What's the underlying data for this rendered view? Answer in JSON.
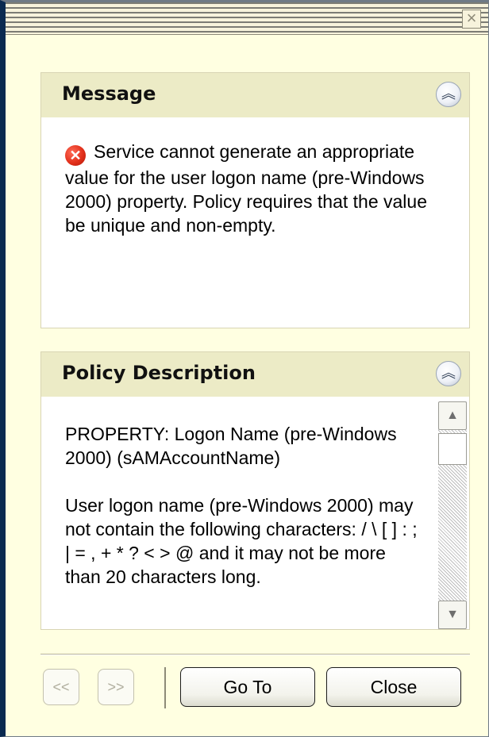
{
  "window": {
    "close_glyph": "×"
  },
  "message": {
    "title": "Message",
    "collapse_glyph": "︽",
    "error_glyph": "✕",
    "text": "Service cannot generate an appropriate value for the user logon name (pre-Windows 2000) property. Policy requires that the value be unique and non-empty."
  },
  "policy": {
    "title": "Policy Description",
    "collapse_glyph": "︽",
    "paragraphs": [
      "PROPERTY: Logon Name (pre-Windows 2000) (sAMAccountName)",
      "User logon name (pre-Windows 2000) may not contain the following characters: / \\ [ ] : ; | = , + * ? < > @ and it may not be more than 20 characters long."
    ],
    "scroll_up_glyph": "▲",
    "scroll_down_glyph": "▼"
  },
  "footer": {
    "prev_label": "<<",
    "next_label": ">>",
    "goto_label": "Go To",
    "close_label": "Close"
  },
  "colors": {
    "background": "#ffffe1",
    "panel_header": "#ecebc6",
    "error_red": "#e2301b"
  },
  "icons": [
    "close-icon",
    "collapse-icon",
    "error-icon",
    "scroll-up-icon",
    "scroll-down-icon"
  ]
}
